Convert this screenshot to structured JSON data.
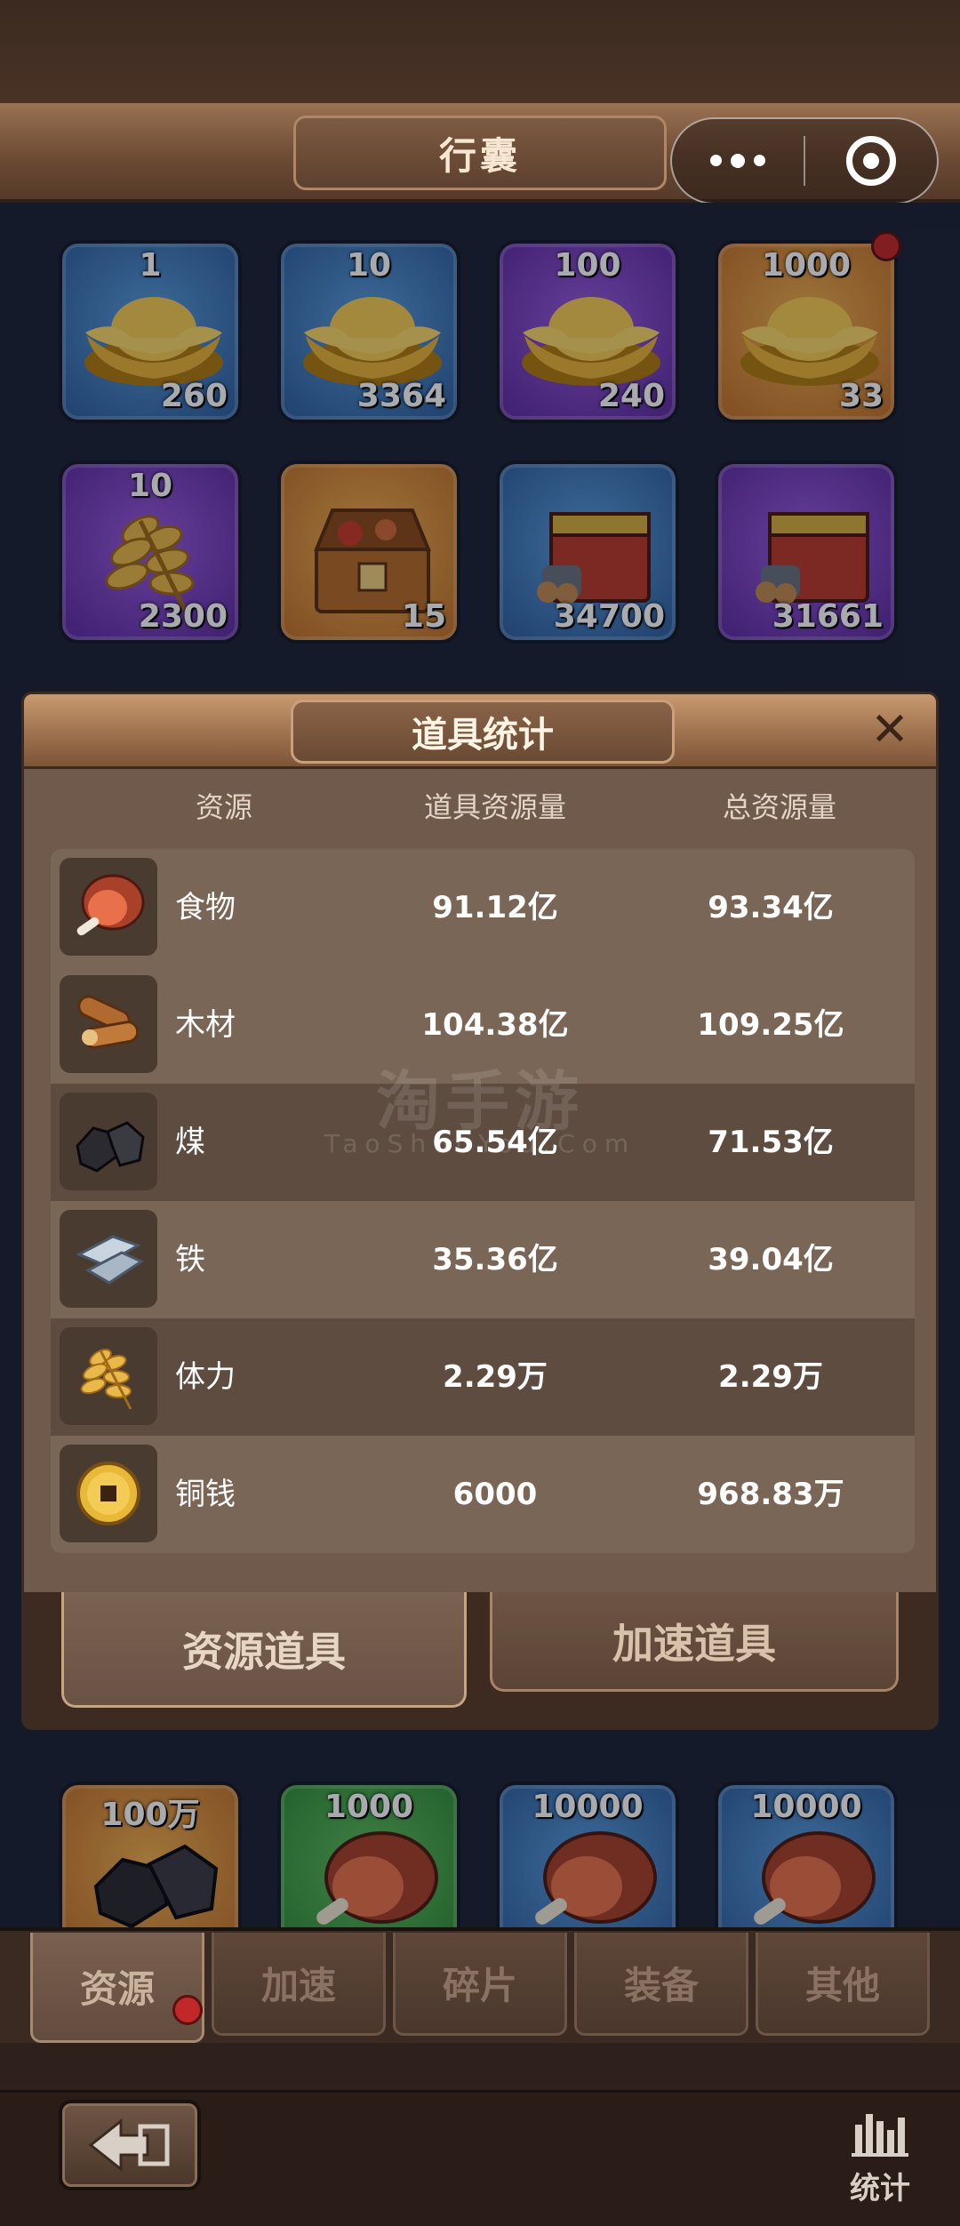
{
  "header": {
    "title": "行囊"
  },
  "inventory": {
    "row1": [
      {
        "top": "1",
        "count": "260",
        "item": "gold-ingot",
        "rarity": "blue"
      },
      {
        "top": "10",
        "count": "3364",
        "item": "gold-ingot",
        "rarity": "blue"
      },
      {
        "top": "100",
        "count": "240",
        "item": "gold-ingot",
        "rarity": "purple"
      },
      {
        "top": "1000",
        "count": "33",
        "item": "gold-ingot",
        "rarity": "orange"
      }
    ],
    "row2": [
      {
        "top": "10",
        "count": "2300",
        "item": "wheat",
        "rarity": "purple"
      },
      {
        "top": "",
        "count": "15",
        "item": "treasure-chest",
        "rarity": "orange"
      },
      {
        "top": "",
        "count": "34700",
        "item": "resource-crate",
        "rarity": "blue"
      },
      {
        "top": "",
        "count": "31661",
        "item": "resource-crate",
        "rarity": "purple"
      }
    ],
    "row_bottom": [
      {
        "top": "100万",
        "item": "coal",
        "rarity": "orange"
      },
      {
        "top": "1000",
        "item": "meat",
        "rarity": "green"
      },
      {
        "top": "10000",
        "item": "meat",
        "rarity": "blue"
      },
      {
        "top": "10000",
        "item": "meat",
        "rarity": "blue"
      }
    ]
  },
  "modal": {
    "title": "道具统计",
    "close": "✕",
    "columns": {
      "resource": "资源",
      "item_amount": "道具资源量",
      "total_amount": "总资源量"
    },
    "rows": [
      {
        "icon": "meat-icon",
        "name": "食物",
        "item_amount": "91.12亿",
        "total_amount": "93.34亿"
      },
      {
        "icon": "wood-icon",
        "name": "木材",
        "item_amount": "104.38亿",
        "total_amount": "109.25亿"
      },
      {
        "icon": "coal-icon",
        "name": "煤",
        "item_amount": "65.54亿",
        "total_amount": "71.53亿"
      },
      {
        "icon": "iron-icon",
        "name": "铁",
        "item_amount": "35.36亿",
        "total_amount": "39.04亿"
      },
      {
        "icon": "wheat-icon",
        "name": "体力",
        "item_amount": "2.29万",
        "total_amount": "2.29万"
      },
      {
        "icon": "coin-icon",
        "name": "铜钱",
        "item_amount": "6000",
        "total_amount": "968.83万"
      }
    ],
    "tabs": {
      "active": "资源道具",
      "inactive": "加速道具"
    }
  },
  "watermark": {
    "main": "淘手游",
    "sub": "TaoShouYou.Com"
  },
  "nav": {
    "tabs": [
      "资源",
      "加速",
      "碎片",
      "装备",
      "其他"
    ],
    "active_index": 0
  },
  "footer": {
    "stats_label": "统计"
  },
  "colors": {
    "accent_red": "#c0282a",
    "panel_brown": "#6f5a4b"
  }
}
